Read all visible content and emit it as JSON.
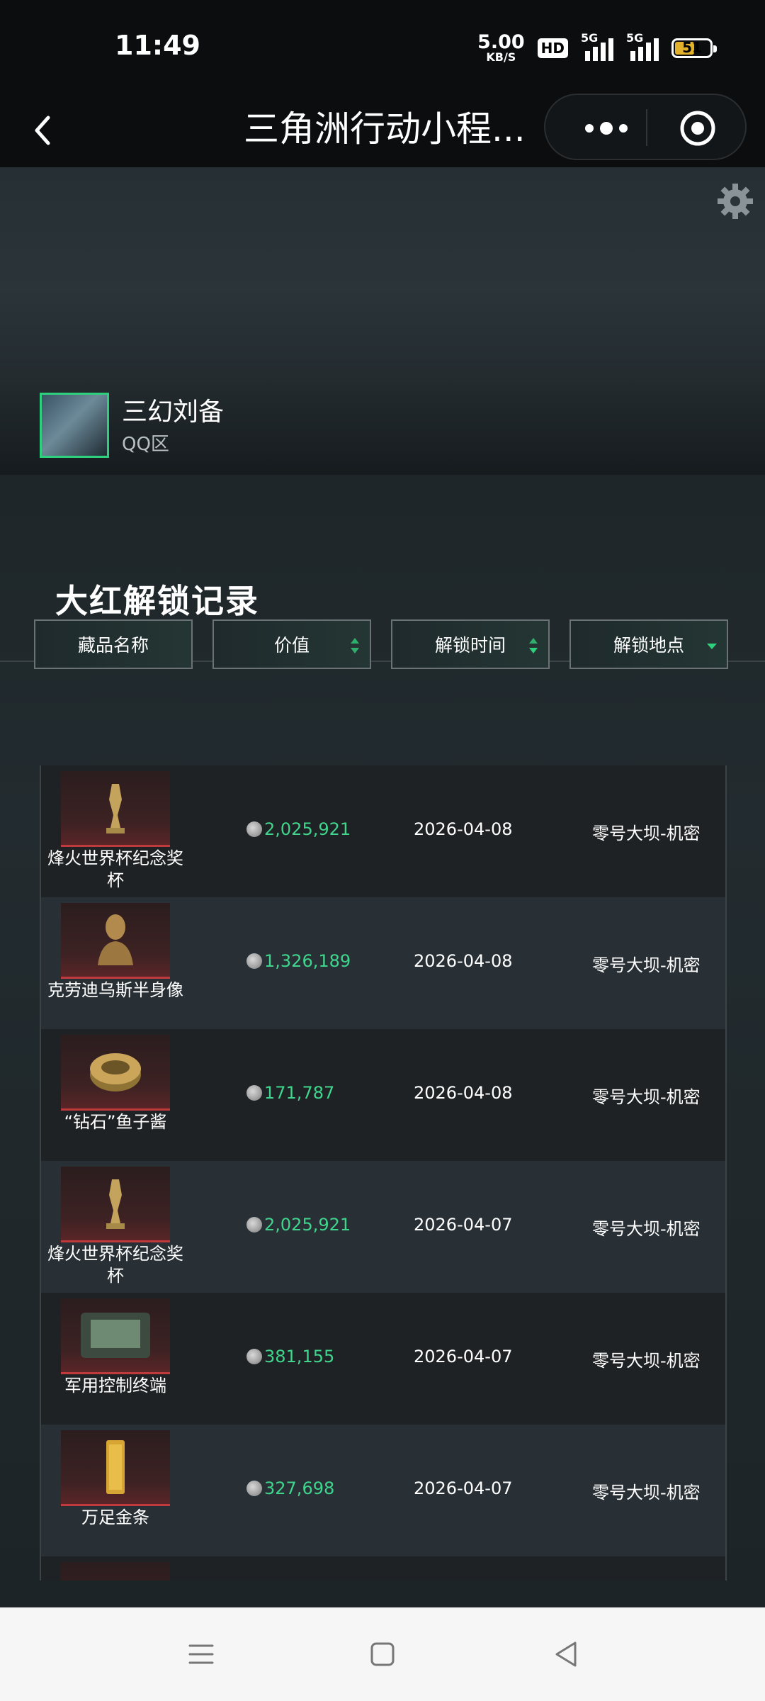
{
  "status": {
    "time": "11:49",
    "net_speed": "5.00",
    "net_unit": "KB/S",
    "hd": "HD",
    "sig1": "5G",
    "sig2": "5G",
    "battery": "51"
  },
  "titlebar": {
    "title": "三角洲行动小程..."
  },
  "profile": {
    "name": "三幻刘备",
    "zone": "QQ区"
  },
  "section": {
    "title": "大红解锁记录"
  },
  "filters": {
    "name": "藏品名称",
    "value": "价值",
    "time": "解锁时间",
    "location": "解锁地点"
  },
  "colors": {
    "accent_green": "#3fd58d",
    "avatar_border": "#2fd07d",
    "rarity_red": "#c0393c"
  },
  "records": [
    {
      "name": "烽火世界杯纪念奖杯",
      "value": "2,025,921",
      "date": "2026-04-08",
      "location": "零号大坝-机密",
      "icon": "trophy-icon"
    },
    {
      "name": "克劳迪乌斯半身像",
      "value": "1,326,189",
      "date": "2026-04-08",
      "location": "零号大坝-机密",
      "icon": "bust-icon"
    },
    {
      "name": "“钻石”鱼子酱",
      "value": "171,787",
      "date": "2026-04-08",
      "location": "零号大坝-机密",
      "icon": "caviar-tin-icon"
    },
    {
      "name": "烽火世界杯纪念奖杯",
      "value": "2,025,921",
      "date": "2026-04-07",
      "location": "零号大坝-机密",
      "icon": "trophy-icon"
    },
    {
      "name": "军用控制终端",
      "value": "381,155",
      "date": "2026-04-07",
      "location": "零号大坝-机密",
      "icon": "terminal-icon"
    },
    {
      "name": "万足金条",
      "value": "327,698",
      "date": "2026-04-07",
      "location": "零号大坝-机密",
      "icon": "gold-bar-icon"
    }
  ]
}
